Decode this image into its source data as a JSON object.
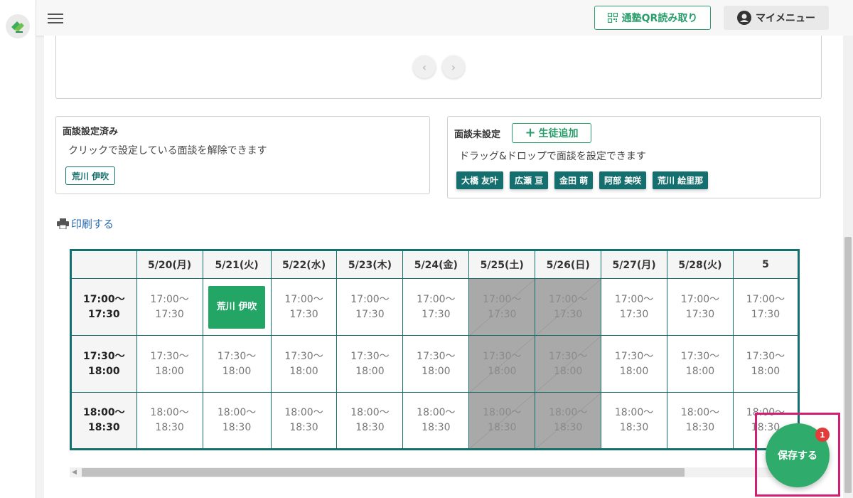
{
  "header": {
    "qr_button_label": "通塾QR読み取り",
    "my_menu_label": "マイメニュー"
  },
  "interview_set": {
    "title": "面談設定済み",
    "description": "クリックで設定している面談を解除できます",
    "students": [
      "荒川 伊吹"
    ]
  },
  "interview_unset": {
    "title": "面談未設定",
    "add_button_label": "生徒追加",
    "description": "ドラッグ&ドロップで面談を設定できます",
    "students": [
      "大橋 友叶",
      "広瀬 亘",
      "金田 萌",
      "阿部 美咲",
      "荒川 絵里那"
    ]
  },
  "print_label": "印刷する",
  "schedule": {
    "dates": [
      "5/20(月)",
      "5/21(火)",
      "5/22(水)",
      "5/23(木)",
      "5/24(金)",
      "5/25(土)",
      "5/26(日)",
      "5/27(月)",
      "5/28(火)",
      "5"
    ],
    "disabled_columns": [
      5,
      6
    ],
    "rows": [
      {
        "start": "17:00〜",
        "end": "17:30"
      },
      {
        "start": "17:30〜",
        "end": "18:00"
      },
      {
        "start": "18:00〜",
        "end": "18:30"
      }
    ],
    "bookings": [
      {
        "row": 0,
        "col": 1,
        "student": "荒川 伊吹"
      }
    ]
  },
  "save_button_label": "保存する",
  "save_badge_count": "1",
  "colors": {
    "primary_green": "#2a9d6a",
    "teal": "#166f6f",
    "booking_green": "#22a565",
    "highlight_pink": "#d21f74",
    "badge_red": "#e33a3a"
  }
}
